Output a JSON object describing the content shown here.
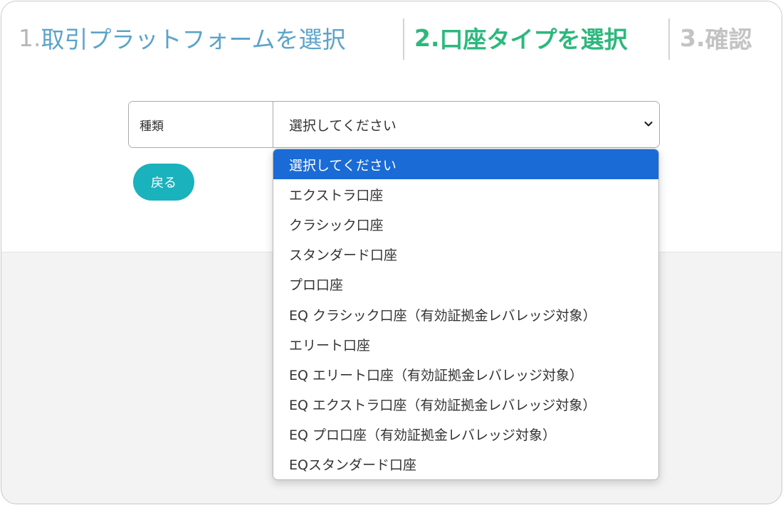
{
  "steps": [
    {
      "num": "1.",
      "label": "取引プラットフォームを選択"
    },
    {
      "num": "2.",
      "label": "口座タイプを選択"
    },
    {
      "num": "3.",
      "label": "確認"
    }
  ],
  "form": {
    "field_label": "種類",
    "select_value": "選択してください",
    "back_button": "戻る"
  },
  "dropdown": {
    "options": [
      "選択してください",
      "エクストラ口座",
      "クラシック口座",
      "スタンダード口座",
      "プロ口座",
      "EQ クラシック口座（有効証拠金レバレッジ対象）",
      "エリート口座",
      "EQ エリート口座（有効証拠金レバレッジ対象）",
      "EQ エクストラ口座（有効証拠金レバレッジ対象）",
      "EQ プロ口座（有効証拠金レバレッジ対象）",
      "EQスタンダード口座"
    ],
    "selected_index": 0
  },
  "colors": {
    "step_active": "#2cb87c",
    "step_done": "#5ba3c9",
    "step_pending": "#c3c3c3",
    "back_button_bg": "#1ab2bc",
    "option_highlight": "#1a6bd6"
  },
  "icons": {
    "select_arrow": "chevron-down-icon"
  }
}
